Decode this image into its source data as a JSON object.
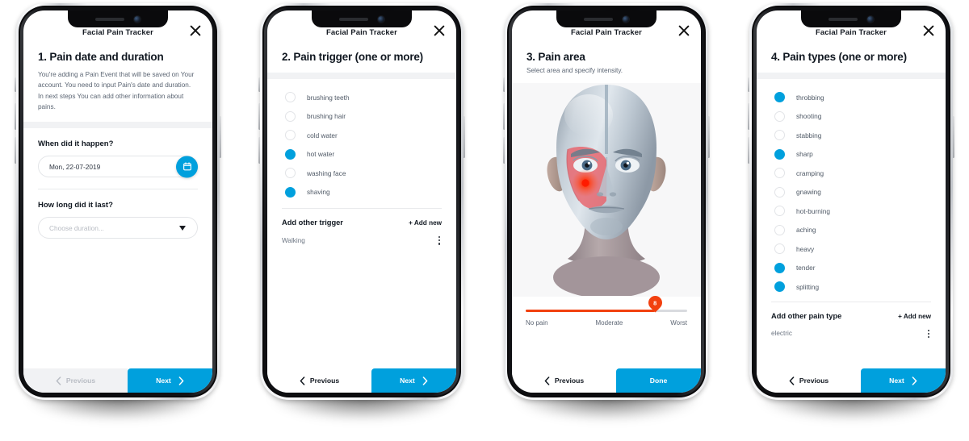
{
  "app": {
    "title": "Facial Pain Tracker",
    "close_icon": "close-x-icon",
    "accent_blue": "#00A0DD",
    "pain_red": "#F2400F"
  },
  "nav": {
    "previous_label": "Previous",
    "next_label": "Next",
    "done_label": "Done",
    "prev_icon": "chevron-left-icon",
    "next_icon": "chevron-right-icon"
  },
  "screen1": {
    "step_title": "1. Pain date and duration",
    "body": "You're adding a Pain Event that will be saved on Your account. You need to input Pain's date and duration. In next steps You can add other information about pains.",
    "date_label": "When did it happen?",
    "date_value": "Mon, 22-07-2019",
    "calendar_icon": "calendar-icon",
    "duration_label": "How long did it last?",
    "duration_placeholder": "Choose duration...",
    "dropdown_icon": "caret-down-icon"
  },
  "screen2": {
    "step_title": "2. Pain trigger (one or more)",
    "options": [
      {
        "label": "brushing teeth",
        "selected": false
      },
      {
        "label": "brushing hair",
        "selected": false
      },
      {
        "label": "cold water",
        "selected": false
      },
      {
        "label": "hot water",
        "selected": true
      },
      {
        "label": "washing face",
        "selected": false
      },
      {
        "label": "shaving",
        "selected": true
      }
    ],
    "add_section_title": "Add other trigger",
    "add_new_label": "+ Add new",
    "custom_items": [
      "Walking"
    ],
    "kebab_icon": "more-vertical-icon"
  },
  "screen3": {
    "step_title": "3. Pain area",
    "subtitle": "Select area and specify intensity.",
    "head_image": "head-front-3d-model",
    "pain_marker": "pain-hotspot-left-cheek",
    "slider": {
      "value": 8,
      "min": 0,
      "max": 10,
      "labels": [
        "No pain",
        "Moderate",
        "Worst"
      ]
    }
  },
  "screen4": {
    "step_title": "4. Pain types (one or more)",
    "options": [
      {
        "label": "throbbing",
        "selected": true
      },
      {
        "label": "shooting",
        "selected": false
      },
      {
        "label": "stabbing",
        "selected": false
      },
      {
        "label": "sharp",
        "selected": true
      },
      {
        "label": "cramping",
        "selected": false
      },
      {
        "label": "gnawing",
        "selected": false
      },
      {
        "label": "hot-burning",
        "selected": false
      },
      {
        "label": "aching",
        "selected": false
      },
      {
        "label": "heavy",
        "selected": false
      },
      {
        "label": "tender",
        "selected": true
      },
      {
        "label": "splitting",
        "selected": true
      }
    ],
    "add_section_title": "Add other pain type",
    "add_new_label": "+ Add new",
    "custom_items": [
      "electric"
    ],
    "kebab_icon": "more-vertical-icon"
  }
}
